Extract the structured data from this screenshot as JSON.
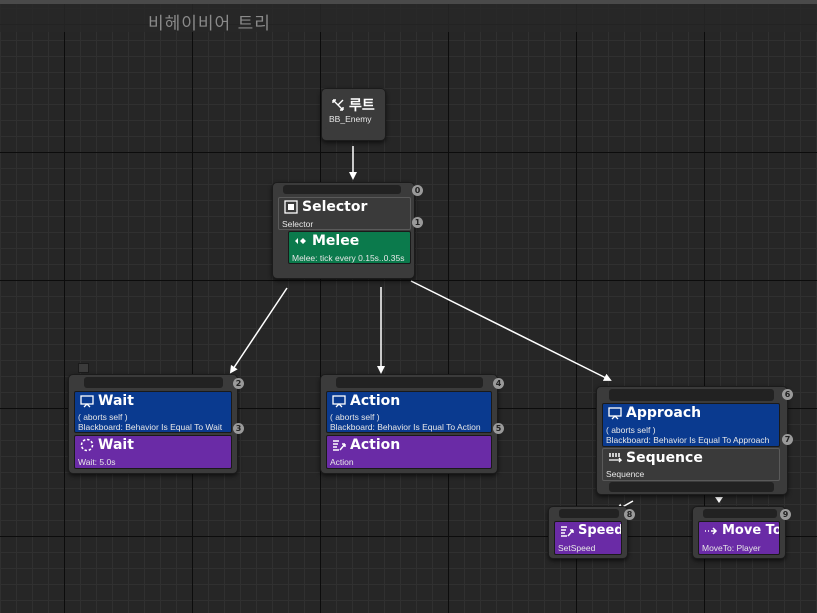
{
  "graph": {
    "title": "비헤이비어 트리"
  },
  "nodes": {
    "root": {
      "title": "루트",
      "subtitle": "BB_Enemy"
    },
    "selector": {
      "index": "0",
      "title": "Selector",
      "subtitle": "Selector",
      "sub_index": "1",
      "service": {
        "title": "Melee",
        "subtitle": "Melee: tick every 0.15s..0.35s"
      }
    },
    "wait": {
      "index": "2",
      "decorator": {
        "title": "Wait",
        "line1": "( aborts self )",
        "line2": "Blackboard: Behavior Is Equal To Wait",
        "index": "3"
      },
      "task": {
        "title": "Wait",
        "subtitle": "Wait: 5.0s"
      }
    },
    "action": {
      "index": "4",
      "decorator": {
        "title": "Action",
        "line1": "( aborts self )",
        "line2": "Blackboard: Behavior Is Equal To Action",
        "index": "5"
      },
      "task": {
        "title": "Action",
        "subtitle": "Action"
      }
    },
    "approach": {
      "index": "6",
      "decorator": {
        "title": "Approach",
        "line1": "( aborts self )",
        "line2": "Blackboard: Behavior Is Equal To Approach",
        "index": "7"
      },
      "composite": {
        "title": "Sequence",
        "subtitle": "Sequence"
      }
    },
    "speed": {
      "index": "8",
      "title": "Speed",
      "subtitle": "SetSpeed"
    },
    "moveto": {
      "index": "9",
      "title": "Move To",
      "subtitle": "MoveTo: Player"
    }
  },
  "icons": {
    "root": "root-arrows-icon",
    "selector": "selector-icon",
    "service": "service-icon",
    "decorator": "blackboard-decorator-icon",
    "wait_task": "wait-task-icon",
    "action_task": "task-icon",
    "sequence": "sequence-icon",
    "speed": "task-icon",
    "moveto": "move-to-icon"
  },
  "colors": {
    "composite": "#3a3a3a",
    "service": "#0b7a4c",
    "decorator": "#0a3a8f",
    "task": "#6a2ba6"
  }
}
